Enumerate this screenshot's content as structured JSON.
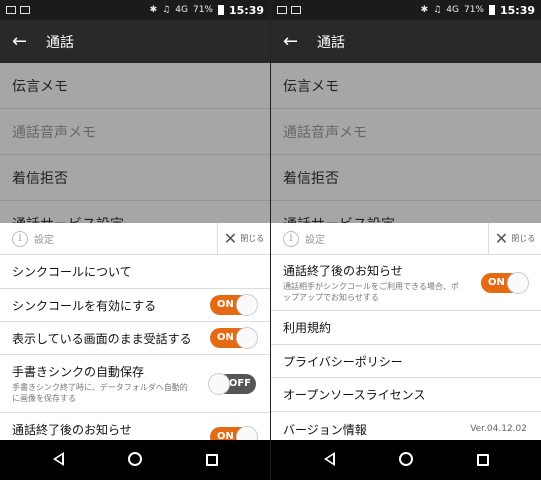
{
  "status": {
    "battery": "71%",
    "time": "15:39",
    "signal": "4G"
  },
  "appbar": {
    "title": "通話"
  },
  "background_list": [
    "伝言メモ",
    "通話音声メモ",
    "着信拒否",
    "通話サービス設定"
  ],
  "sheet": {
    "header_label": "設定",
    "close_label": "閉じる"
  },
  "left_rows": [
    {
      "label": "シンクコールについて"
    },
    {
      "label": "シンクコールを有効にする",
      "toggle": "ON"
    },
    {
      "label": "表示している画面のまま受話する",
      "toggle": "ON"
    },
    {
      "label": "手書きシンクの自動保存",
      "sub": "手書きシンク終了時に、データフォルダへ自動的に画像を保存する",
      "toggle": "OFF"
    },
    {
      "label": "通話終了後のお知らせ",
      "toggle": "ON"
    }
  ],
  "right_rows": [
    {
      "label": "通話終了後のお知らせ",
      "sub": "通話相手がシンクコールをご利用できる場合、ポップアップでお知らせする",
      "toggle": "ON"
    },
    {
      "label": "利用規約"
    },
    {
      "label": "プライバシーポリシー"
    },
    {
      "label": "オープンソースライセンス"
    },
    {
      "label": "バージョン情報",
      "version": "Ver.04.12.02"
    }
  ],
  "colors": {
    "accent": "#e56a14",
    "appbar": "#292929",
    "overlay": "#a6a6a6"
  }
}
